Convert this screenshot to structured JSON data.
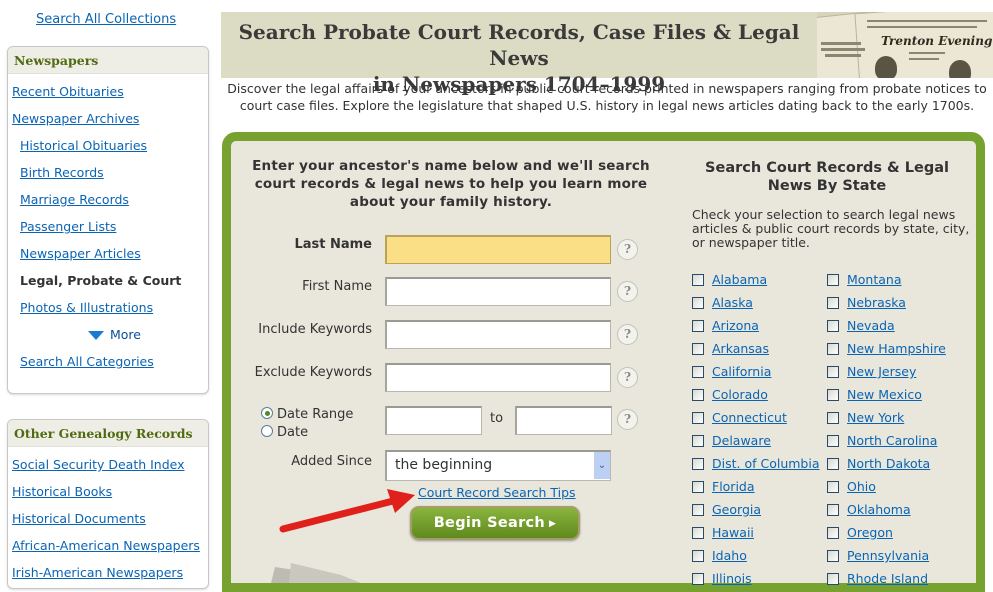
{
  "sidebar": {
    "search_all_collections": "Search All Collections",
    "newspapers": {
      "title": "Newspapers",
      "items": [
        {
          "label": "Recent Obituaries",
          "level": 0,
          "current": false
        },
        {
          "label": "Newspaper Archives",
          "level": 0,
          "current": false
        },
        {
          "label": "Historical Obituaries",
          "level": 1,
          "current": false
        },
        {
          "label": "Birth Records",
          "level": 1,
          "current": false
        },
        {
          "label": "Marriage Records",
          "level": 1,
          "current": false
        },
        {
          "label": "Passenger Lists",
          "level": 1,
          "current": false
        },
        {
          "label": "Newspaper Articles",
          "level": 1,
          "current": false
        },
        {
          "label": "Legal, Probate & Court",
          "level": 1,
          "current": true
        },
        {
          "label": "Photos & Illustrations",
          "level": 1,
          "current": false
        }
      ],
      "more_label": "More",
      "search_all_categories": "Search All Categories"
    },
    "other": {
      "title": "Other Genealogy Records",
      "items": [
        "Social Security Death Index",
        "Historical Books",
        "Historical Documents",
        "African-American Newspapers",
        "Irish-American Newspapers"
      ]
    }
  },
  "banner": {
    "title_line1": "Search Probate Court Records, Case Files & Legal News",
    "title_line2": "in Newspapers 1704–1999",
    "image_masthead": "Trenton Evening Times"
  },
  "intro": "Discover the legal affairs of your ancestors in public court records printed in newspapers ranging from probate notices to court case files. Explore the legislature that shaped U.S. history in legal news articles dating back to the early 1700s.",
  "form": {
    "intro": "Enter your ancestor's name below and we'll search court records & legal news to help you learn more about your family history.",
    "fields": {
      "last_name": {
        "label": "Last Name",
        "value": ""
      },
      "first_name": {
        "label": "First Name",
        "value": ""
      },
      "include_keywords": {
        "label": "Include Keywords",
        "value": ""
      },
      "exclude_keywords": {
        "label": "Exclude Keywords",
        "value": ""
      }
    },
    "date_mode": {
      "options": [
        "Date Range",
        "Date"
      ],
      "selected": "Date Range"
    },
    "date_from": "",
    "date_to_label": "to",
    "date_to": "",
    "added_since": {
      "label": "Added Since",
      "selected": "the beginning"
    },
    "help_glyph": "?",
    "tips_link": "Court Record Search Tips",
    "submit_label": "Begin Search"
  },
  "states": {
    "title": "Search Court Records & Legal News By State",
    "description": "Check your selection to search legal news articles & public court records by state, city, or newspaper title.",
    "column1": [
      "Alabama",
      "Alaska",
      "Arizona",
      "Arkansas",
      "California",
      "Colorado",
      "Connecticut",
      "Delaware",
      "Dist. of Columbia",
      "Florida",
      "Georgia",
      "Hawaii",
      "Idaho",
      "Illinois"
    ],
    "column2": [
      "Montana",
      "Nebraska",
      "Nevada",
      "New Hampshire",
      "New Jersey",
      "New Mexico",
      "New York",
      "North Carolina",
      "North Dakota",
      "Ohio",
      "Oklahoma",
      "Oregon",
      "Pennsylvania",
      "Rhode Island"
    ]
  },
  "colors": {
    "brand_green": "#78a22f",
    "link_blue": "#0a64b4",
    "highlight_input": "#fbdf86",
    "panel_bg": "#e9e7dc",
    "annotation_arrow": "#e0201a"
  }
}
